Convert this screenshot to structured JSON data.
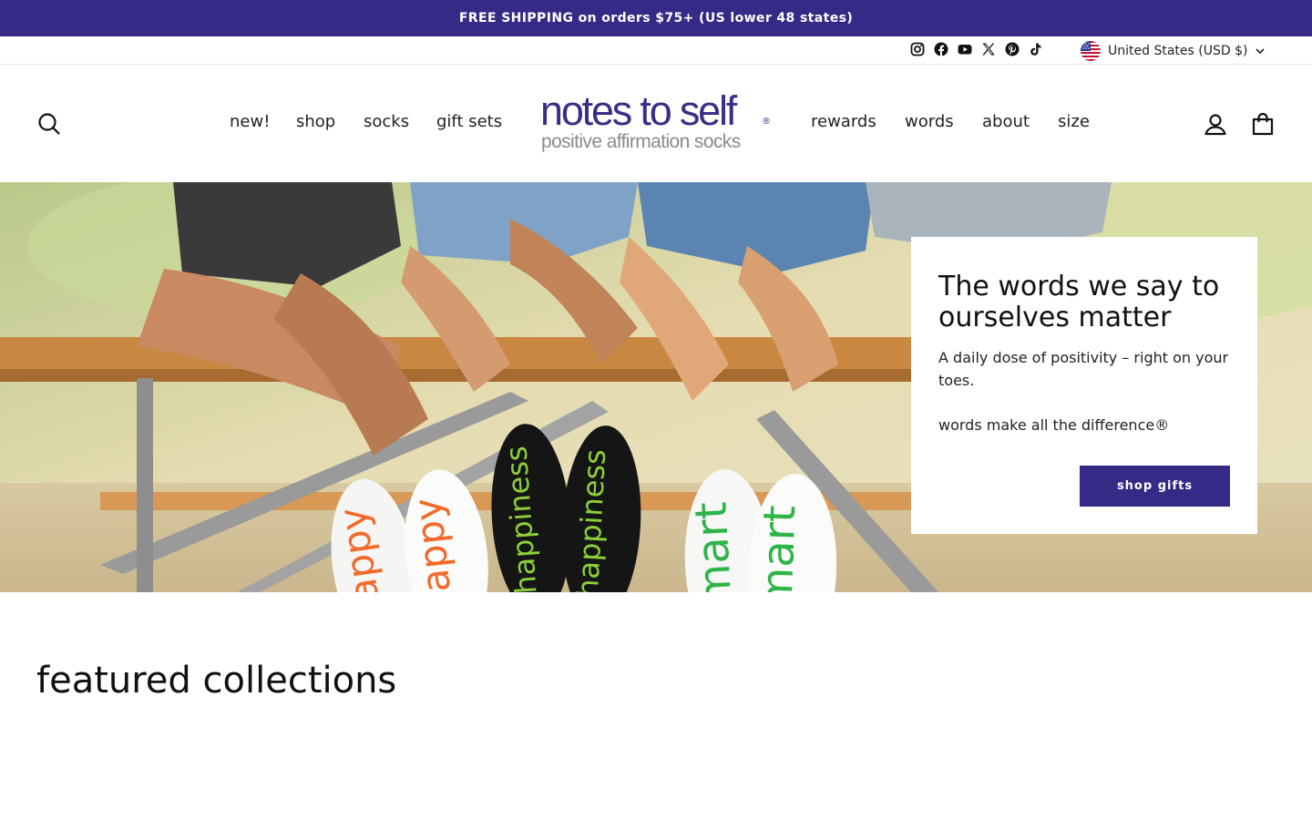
{
  "announcement": {
    "text": "FREE SHIPPING on orders $75+ (US lower 48 states)"
  },
  "utility": {
    "socials": [
      {
        "name": "Instagram",
        "icon": "instagram-icon"
      },
      {
        "name": "Facebook",
        "icon": "facebook-icon"
      },
      {
        "name": "YouTube",
        "icon": "youtube-icon"
      },
      {
        "name": "X",
        "icon": "x-icon"
      },
      {
        "name": "Pinterest",
        "icon": "pinterest-icon"
      },
      {
        "name": "TikTok",
        "icon": "tiktok-icon"
      }
    ],
    "locale": {
      "label": "United States (USD $)",
      "icon": "us-flag-icon"
    }
  },
  "header": {
    "nav_left": [
      "new!",
      "shop",
      "socks",
      "gift sets"
    ],
    "nav_right": [
      "rewards",
      "words",
      "about",
      "size"
    ],
    "logo": {
      "main": "notes to self",
      "registered": "®",
      "tagline": "positive affirmation socks"
    },
    "icons": {
      "search": "search-icon",
      "account": "account-icon",
      "cart": "cart-icon"
    }
  },
  "hero": {
    "title": "The words we say to ourselves matter",
    "text": "A daily dose of positivity – right on your toes.",
    "tagline": "words make all the difference®",
    "button_label": "shop gifts",
    "sock_words": [
      "happy",
      "happy",
      "happiness",
      "happiness",
      "smart",
      "smart"
    ]
  },
  "featured": {
    "title": "featured collections"
  },
  "colors": {
    "brand": "#352a85",
    "logo_purple": "#3a2f86",
    "logo_gray": "#8a8a8a"
  }
}
